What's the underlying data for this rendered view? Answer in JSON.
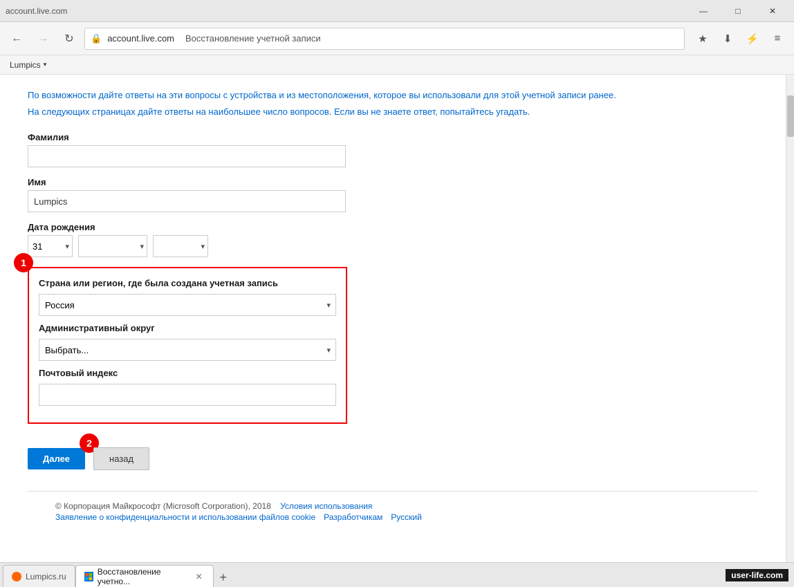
{
  "browser": {
    "url": "account.live.com",
    "page_title": "Восстановление учетной записи",
    "back_button": "←",
    "refresh_button": "↻",
    "bookmark_items": [
      {
        "label": "Lumpics",
        "has_chevron": true
      }
    ],
    "nav_icons": {
      "lock": "🔒",
      "star": "★",
      "download": "⬇",
      "lightning": "⚡",
      "menu": "≡",
      "minimize": "—",
      "restore": "□",
      "close": "✕"
    }
  },
  "page": {
    "intro_line1": "По возможности дайте ответы на эти вопросы с устройства и из местоположения, которое вы использовали для этой учетной записи",
    "intro_line1_suffix": "ранее.",
    "intro_line2": "На следующих страницах дайте ответы на наибольшее число вопросов. Если вы не знаете ответ, попытайтесь угадать.",
    "last_name_label": "Фамилия",
    "last_name_value": "",
    "first_name_label": "Имя",
    "first_name_value": "Lumpics",
    "birthdate_label": "Дата рождения",
    "birthdate_day": "31",
    "birthdate_month": "",
    "birthdate_year": "",
    "section1_label": "Страна или регион, где была создана учетная запись",
    "country_value": "Россия",
    "district_label": "Административный округ",
    "district_value": "Выбрать...",
    "postal_label": "Почтовый индекс",
    "postal_value": "",
    "btn_next": "Далее",
    "btn_back": "назад",
    "number_badge_1": "1",
    "number_badge_2": "2",
    "footer_copyright": "© Корпорация Майкрософт (Microsoft Corporation), 2018",
    "footer_link1": "Условия использования",
    "footer_link2": "Заявление о конфиденциальности и использовании файлов cookie",
    "footer_link3": "Разработчикам",
    "footer_link4": "Русский"
  },
  "tabs": [
    {
      "label": "Lumpics.ru",
      "favicon_type": "lumpics",
      "active": false
    },
    {
      "label": "Восстановление учетно...",
      "favicon_type": "ms",
      "active": true,
      "closeable": true
    }
  ],
  "watermark": "user-life.com"
}
